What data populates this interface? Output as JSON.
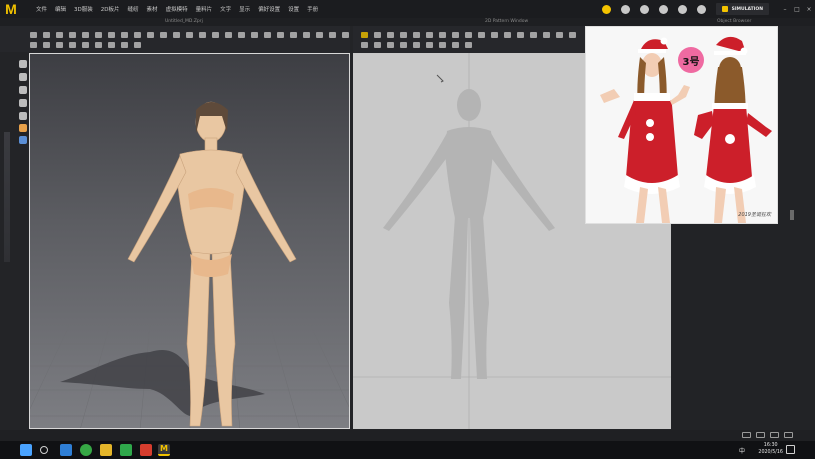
{
  "app": {
    "logo_letter": "M",
    "menu": [
      "文件",
      "编辑",
      "3D服装",
      "2D板片",
      "缝纫",
      "素材",
      "虚拟模特",
      "量料片",
      "文字",
      "显示",
      "偏好设置",
      "设置",
      "手册"
    ],
    "simulation_label": "SIMULATION",
    "window_controls": [
      "–",
      "□",
      "×"
    ]
  },
  "windows": {
    "viewport_3d_title": "Untitled_MD.Zprj",
    "pattern_window_title": "2D Pattern Window",
    "object_browser_title": "Object Browser"
  },
  "reference_photo": {
    "badge_text": "3号",
    "watermark": "2019圣诞狂欢",
    "colors": {
      "dress": "#cc1f2a",
      "fur": "#ffffff",
      "skin": "#f2cdb4",
      "hair": "#8b5a2b"
    }
  },
  "taskbar": {
    "ime": "中",
    "time": "16:30",
    "date": "2020/5/16"
  },
  "colors": {
    "accent": "#f2c200",
    "viewport_border": "#d8d8d8",
    "pattern_bg": "#c9c9c9"
  },
  "icons": {
    "toolbar_left": "simulation-tool-icons",
    "toolbar_right": "pattern-tool-icons",
    "start": "windows-start-icon",
    "search": "search-icon",
    "browser": "browser-icon",
    "md": "marvelous-designer-icon"
  }
}
